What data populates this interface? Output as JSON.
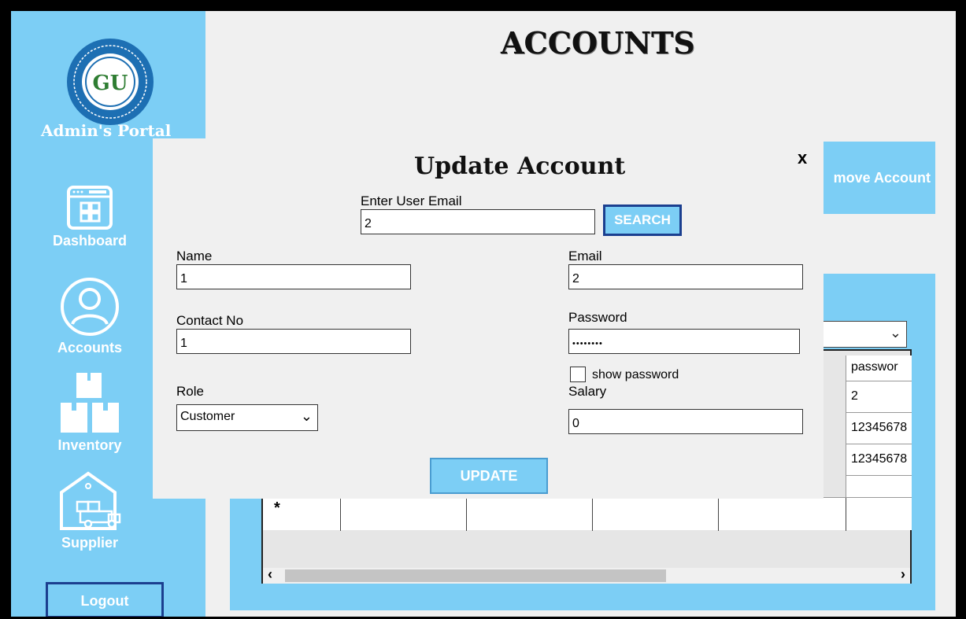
{
  "window": {
    "title": "ACCOUNTS"
  },
  "sidebar": {
    "portal_title": "Admin's Portal",
    "logo_initials": "GU",
    "items": [
      {
        "label": "Dashboard",
        "icon": "dashboard-icon"
      },
      {
        "label": "Accounts",
        "icon": "user-icon"
      },
      {
        "label": "Inventory",
        "icon": "boxes-icon"
      },
      {
        "label": "Supplier",
        "icon": "warehouse-truck-icon"
      }
    ],
    "logout_label": "Logout"
  },
  "main": {
    "remove_button_label": "move Account",
    "grid": {
      "header": "passwor",
      "cells": [
        "2",
        "12345678",
        "12345678"
      ],
      "new_row_marker": "*"
    }
  },
  "dialog": {
    "title": "Update Account",
    "close_label": "x",
    "search": {
      "label": "Enter User Email",
      "value": "2",
      "button_label": "SEARCH"
    },
    "name": {
      "label": "Name",
      "value": "1"
    },
    "email": {
      "label": "Email",
      "value": "2"
    },
    "contact": {
      "label": "Contact No",
      "value": "1"
    },
    "password": {
      "label": "Password",
      "value": "••••••••"
    },
    "show_password_label": "show password",
    "role": {
      "label": "Role",
      "value": "Customer"
    },
    "salary": {
      "label": "Salary",
      "value": "0"
    },
    "update_label": "UPDATE"
  },
  "colors": {
    "accent": "#7ccef5",
    "button_border": "#1b3f8f"
  }
}
